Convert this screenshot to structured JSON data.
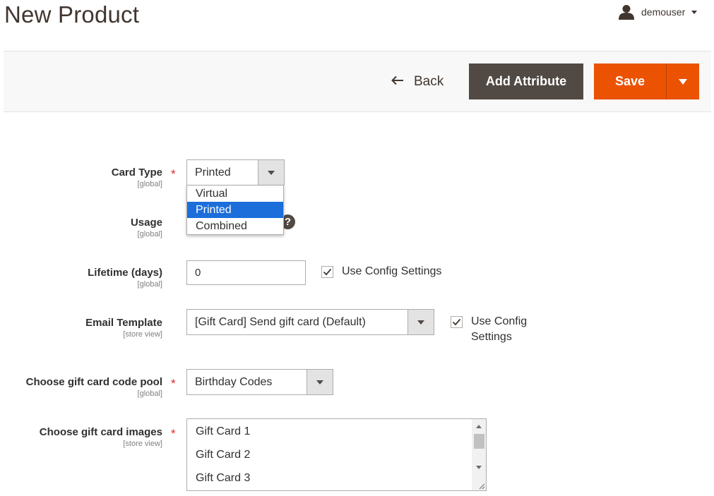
{
  "header": {
    "title": "New Product",
    "user": {
      "name": "demouser",
      "icon": "user-icon"
    }
  },
  "actions": {
    "back_label": "Back",
    "add_attribute_label": "Add Attribute",
    "save_label": "Save"
  },
  "colors": {
    "accent": "#eb5202",
    "secondary_button": "#514943",
    "selected_option": "#1c6edb",
    "required": "#e22626"
  },
  "form": {
    "card_type": {
      "label": "Card Type",
      "scope": "[global]",
      "required": true,
      "value": "Printed",
      "options": [
        "Virtual",
        "Printed",
        "Combined"
      ],
      "highlighted": "Printed"
    },
    "usage": {
      "label": "Usage",
      "scope": "[global]",
      "help_icon": "?"
    },
    "lifetime": {
      "label": "Lifetime (days)",
      "scope": "[global]",
      "value": "0",
      "use_config_label": "Use Config Settings",
      "use_config_checked": true
    },
    "email_template": {
      "label": "Email Template",
      "scope": "[store view]",
      "value": "[Gift Card] Send gift card (Default)",
      "use_config_label_1": "Use Config",
      "use_config_label_2": "Settings",
      "use_config_checked": true
    },
    "code_pool": {
      "label": "Choose gift card code pool",
      "scope": "[global]",
      "required": true,
      "value": "Birthday Codes"
    },
    "images": {
      "label": "Choose gift card images",
      "scope": "[store view]",
      "required": true,
      "options": [
        "Gift Card 1",
        "Gift Card 2",
        "Gift Card 3"
      ]
    }
  }
}
